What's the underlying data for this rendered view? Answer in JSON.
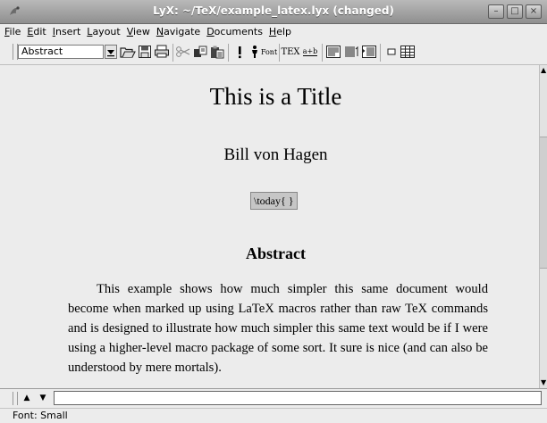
{
  "window": {
    "title": "LyX: ~/TeX/example_latex.lyx (changed)",
    "controls": [
      "minimize",
      "maximize",
      "close"
    ]
  },
  "menubar": {
    "items": [
      {
        "label": "File",
        "underline": "F",
        "rest": "ile"
      },
      {
        "label": "Edit",
        "underline": "E",
        "rest": "dit"
      },
      {
        "label": "Insert",
        "underline": "I",
        "rest": "nsert"
      },
      {
        "label": "Layout",
        "underline": "L",
        "rest": "ayout"
      },
      {
        "label": "View",
        "underline": "V",
        "rest": "iew"
      },
      {
        "label": "Navigate",
        "underline": "N",
        "rest": "avigate"
      },
      {
        "label": "Documents",
        "underline": "D",
        "rest": "ocuments"
      },
      {
        "label": "Help",
        "underline": "H",
        "rest": "elp"
      }
    ]
  },
  "toolbar": {
    "layout_value": "Abstract",
    "font_label": "Font",
    "tex_label": "TEX",
    "math_label": "a+b"
  },
  "document": {
    "title": "This is a Title",
    "author": "Bill von Hagen",
    "date_inset": "\\today{ }",
    "abstract_heading": "Abstract",
    "abstract_text": "This example shows how much simpler this same document would become when marked up using LaTeX macros rather than raw TeX commands and is designed to illustrate how much simpler this same text would be if I were using a higher-level macro package of some sort. It sure is nice (and can also be understood by mere mortals)."
  },
  "statusbar": {
    "text": "Font: Small"
  }
}
